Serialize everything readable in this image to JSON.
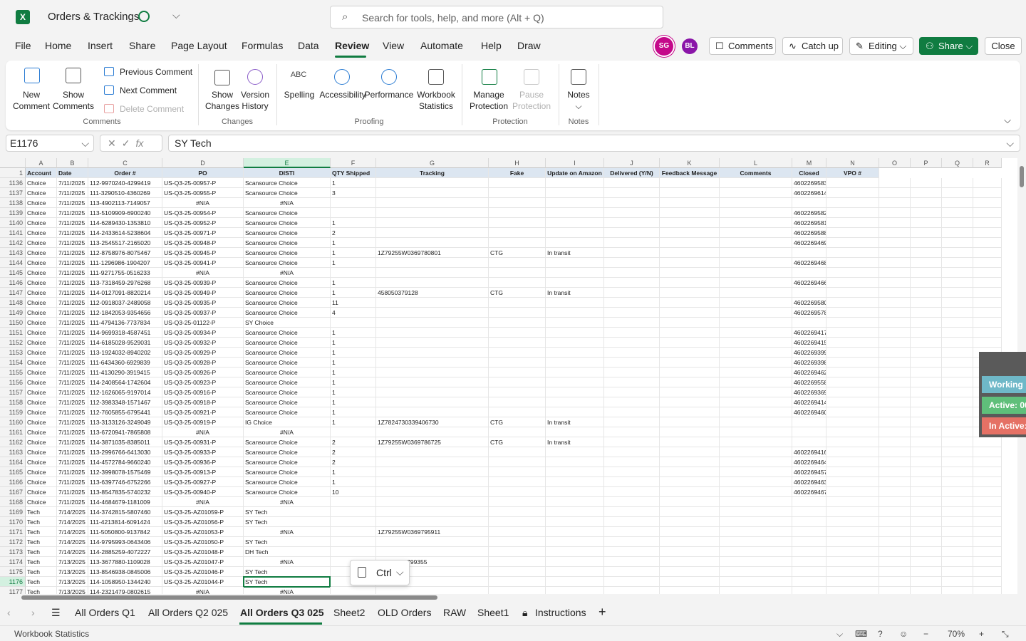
{
  "app": {
    "title": "Orders & Trackings",
    "search_placeholder": "Search for tools, help, and more (Alt + Q)",
    "brand_color": "#107c41"
  },
  "menu": {
    "tabs": [
      "File",
      "Home",
      "Insert",
      "Share",
      "Page Layout",
      "Formulas",
      "Data",
      "Review",
      "View",
      "Automate",
      "Help",
      "Draw"
    ],
    "active": "Review"
  },
  "avatars": [
    {
      "initials": "SG",
      "color": "#c4098a"
    },
    {
      "initials": "BL",
      "color": "#8a15a8"
    }
  ],
  "toolbar": {
    "comments": "Comments",
    "catchup": "Catch up",
    "editing": "Editing",
    "share": "Share",
    "close": "Close"
  },
  "ribbon": {
    "new_comment": [
      "New",
      "Comment"
    ],
    "show_comments": [
      "Show",
      "Comments"
    ],
    "previous_comment": "Previous Comment",
    "next_comment": "Next Comment",
    "delete_comment": "Delete Comment",
    "group_comments": "Comments",
    "show_changes": [
      "Show",
      "Changes"
    ],
    "version_history": [
      "Version",
      "History"
    ],
    "group_changes": "Changes",
    "spelling": "Spelling",
    "spelling_icon_text": "ABC",
    "accessibility": "Accessibility",
    "performance": "Performance",
    "workbook_statistics": [
      "Workbook",
      "Statistics"
    ],
    "group_proofing": "Proofing",
    "manage_protection": [
      "Manage",
      "Protection"
    ],
    "pause_protection": [
      "Pause",
      "Protection"
    ],
    "group_protection": "Protection",
    "notes": "Notes",
    "group_notes": "Notes"
  },
  "formula_bar": {
    "name_box": "E1176",
    "fx": "fx",
    "value": "SY Tech"
  },
  "sheet": {
    "columns": [
      "A",
      "B",
      "C",
      "D",
      "E",
      "F",
      "G",
      "H",
      "I",
      "J",
      "K",
      "L",
      "M",
      "N",
      "O",
      "P",
      "Q",
      "R"
    ],
    "selected_column": "E",
    "header_row_number": "1",
    "headers": [
      "Account",
      "Date",
      "Order #",
      "PO",
      "DISTI",
      "QTY Shipped",
      "Tracking",
      "Fake",
      "Update on Amazon",
      "Delivered (Y/N)",
      "Feedback Message",
      "Comments",
      "Closed",
      "VPO #"
    ],
    "selected_row": "1176",
    "rows": [
      [
        "1136",
        "Choice",
        "7/11/2025",
        "112-9970240-4299419",
        "US-Q3-25-00957-P",
        "Scansource Choice",
        "1",
        "",
        "",
        "",
        "",
        "",
        "",
        "4602269583"
      ],
      [
        "1137",
        "Choice",
        "7/11/2025",
        "111-3290510-4360269",
        "US-Q3-25-00955-P",
        "Scansource Choice",
        "3",
        "",
        "",
        "",
        "",
        "",
        "",
        "4602269614"
      ],
      [
        "1138",
        "Choice",
        "7/11/2025",
        "113-4902113-7149057",
        "#N/A",
        "#N/A",
        "",
        "",
        "",
        "",
        "",
        "",
        "",
        ""
      ],
      [
        "1139",
        "Choice",
        "7/11/2025",
        "113-5109909-6900240",
        "US-Q3-25-00954-P",
        "Scansource Choice",
        "",
        "",
        "",
        "",
        "",
        "",
        "",
        "4602269582"
      ],
      [
        "1140",
        "Choice",
        "7/11/2025",
        "114-6289430-1353810",
        "US-Q3-25-00952-P",
        "Scansource Choice",
        "1",
        "",
        "",
        "",
        "",
        "",
        "",
        "4602269581"
      ],
      [
        "1141",
        "Choice",
        "7/11/2025",
        "114-2433614-5238604",
        "US-Q3-25-00971-P",
        "Scansource Choice",
        "2",
        "",
        "",
        "",
        "",
        "",
        "",
        "4602269588"
      ],
      [
        "1142",
        "Choice",
        "7/11/2025",
        "113-2545517-2165020",
        "US-Q3-25-00948-P",
        "Scansource Choice",
        "1",
        "",
        "",
        "",
        "",
        "",
        "",
        "4602269469"
      ],
      [
        "1143",
        "Choice",
        "7/11/2025",
        "112-8758976-8075467",
        "US-Q3-25-00945-P",
        "Scansource Choice",
        "1",
        "1Z79255W0369780801",
        "CTG",
        "In transit",
        "",
        "",
        "",
        ""
      ],
      [
        "1144",
        "Choice",
        "7/11/2025",
        "111-1296986-1904207",
        "US-Q3-25-00941-P",
        "Scansource Choice",
        "1",
        "",
        "",
        "",
        "",
        "",
        "",
        "4602269468"
      ],
      [
        "1145",
        "Choice",
        "7/11/2025",
        "111-9271755-0516233",
        "#N/A",
        "#N/A",
        "",
        "",
        "",
        "",
        "",
        "",
        "",
        ""
      ],
      [
        "1146",
        "Choice",
        "7/11/2025",
        "113-7318459-2976268",
        "US-Q3-25-00939-P",
        "Scansource Choice",
        "1",
        "",
        "",
        "",
        "",
        "",
        "",
        "4602269466"
      ],
      [
        "1147",
        "Choice",
        "7/11/2025",
        "114-0127091-8820214",
        "US-Q3-25-00949-P",
        "Scansource Choice",
        "1",
        "458050379128",
        "CTG",
        "In transit",
        "",
        "",
        "",
        ""
      ],
      [
        "1148",
        "Choice",
        "7/11/2025",
        "112-0918037-2489058",
        "US-Q3-25-00935-P",
        "Scansource Choice",
        "11",
        "",
        "",
        "",
        "",
        "",
        "",
        "4602269580"
      ],
      [
        "1149",
        "Choice",
        "7/11/2025",
        "112-1842053-9354656",
        "US-Q3-25-00937-P",
        "Scansource Choice",
        "4",
        "",
        "",
        "",
        "",
        "",
        "",
        "4602269578"
      ],
      [
        "1150",
        "Choice",
        "7/11/2025",
        "111-4794136-7737834",
        "US-Q3-25-01122-P",
        "SY Choice",
        "",
        "",
        "",
        "",
        "",
        "",
        "",
        ""
      ],
      [
        "1151",
        "Choice",
        "7/11/2025",
        "114-9699318-4587451",
        "US-Q3-25-00934-P",
        "Scansource Choice",
        "1",
        "",
        "",
        "",
        "",
        "",
        "",
        "4602269417"
      ],
      [
        "1152",
        "Choice",
        "7/11/2025",
        "114-6185028-9529031",
        "US-Q3-25-00932-P",
        "Scansource Choice",
        "1",
        "",
        "",
        "",
        "",
        "",
        "",
        "4602269415"
      ],
      [
        "1153",
        "Choice",
        "7/11/2025",
        "113-1924032-8940202",
        "US-Q3-25-00929-P",
        "Scansource Choice",
        "1",
        "",
        "",
        "",
        "",
        "",
        "",
        "4602269399"
      ],
      [
        "1154",
        "Choice",
        "7/11/2025",
        "111-6434360-6929839",
        "US-Q3-25-00928-P",
        "Scansource Choice",
        "1",
        "",
        "",
        "",
        "",
        "",
        "",
        "4602269398"
      ],
      [
        "1155",
        "Choice",
        "7/11/2025",
        "111-4130290-3919415",
        "US-Q3-25-00926-P",
        "Scansource Choice",
        "1",
        "",
        "",
        "",
        "",
        "",
        "",
        "4602269462"
      ],
      [
        "1156",
        "Choice",
        "7/11/2025",
        "114-2408564-1742604",
        "US-Q3-25-00923-P",
        "Scansource Choice",
        "1",
        "",
        "",
        "",
        "",
        "",
        "",
        "4602269558"
      ],
      [
        "1157",
        "Choice",
        "7/11/2025",
        "112-1626065-9197014",
        "US-Q3-25-00916-P",
        "Scansource Choice",
        "1",
        "",
        "",
        "",
        "",
        "",
        "",
        "4602269369"
      ],
      [
        "1158",
        "Choice",
        "7/11/2025",
        "112-3983348-1571467",
        "US-Q3-25-00918-P",
        "Scansource Choice",
        "1",
        "",
        "",
        "",
        "",
        "",
        "",
        "4602269414"
      ],
      [
        "1159",
        "Choice",
        "7/11/2025",
        "112-7605855-6795441",
        "US-Q3-25-00921-P",
        "Scansource Choice",
        "1",
        "",
        "",
        "",
        "",
        "",
        "",
        "4602269460"
      ],
      [
        "1160",
        "Choice",
        "7/11/2025",
        "113-3133126-3249049",
        "US-Q3-25-00919-P",
        "IG Choice",
        "1",
        "1Z7824730339406730",
        "CTG",
        "In transit",
        "",
        "",
        "",
        ""
      ],
      [
        "1161",
        "Choice",
        "7/11/2025",
        "113-6720941-7865808",
        "#N/A",
        "#N/A",
        "",
        "",
        "",
        "",
        "",
        "",
        "",
        ""
      ],
      [
        "1162",
        "Choice",
        "7/11/2025",
        "114-3871035-8385011",
        "US-Q3-25-00931-P",
        "Scansource Choice",
        "2",
        "1Z79255W0369786725",
        "CTG",
        "In transit",
        "",
        "",
        "",
        ""
      ],
      [
        "1163",
        "Choice",
        "7/11/2025",
        "113-2996766-6413030",
        "US-Q3-25-00933-P",
        "Scansource Choice",
        "2",
        "",
        "",
        "",
        "",
        "",
        "",
        "4602269416"
      ],
      [
        "1164",
        "Choice",
        "7/11/2025",
        "114-4572784-9660240",
        "US-Q3-25-00936-P",
        "Scansource Choice",
        "2",
        "",
        "",
        "",
        "",
        "",
        "",
        "4602269464"
      ],
      [
        "1165",
        "Choice",
        "7/11/2025",
        "112-3998078-1575469",
        "US-Q3-25-00913-P",
        "Scansource Choice",
        "1",
        "",
        "",
        "",
        "",
        "",
        "",
        "4602269457"
      ],
      [
        "1166",
        "Choice",
        "7/11/2025",
        "113-6397746-6752266",
        "US-Q3-25-00927-P",
        "Scansource Choice",
        "1",
        "",
        "",
        "",
        "",
        "",
        "",
        "4602269463"
      ],
      [
        "1167",
        "Choice",
        "7/11/2025",
        "113-8547835-5740232",
        "US-Q3-25-00940-P",
        "Scansource Choice",
        "10",
        "",
        "",
        "",
        "",
        "",
        "",
        "4602269467"
      ],
      [
        "1168",
        "Choice",
        "7/11/2025",
        "114-4684679-1181009",
        "#N/A",
        "#N/A",
        "",
        "",
        "",
        "",
        "",
        "",
        "",
        ""
      ],
      [
        "1169",
        "Tech",
        "7/14/2025",
        "114-3742815-5807460",
        "US-Q3-25-AZ01059-P",
        "SY Tech",
        "",
        "",
        "",
        "",
        "",
        "",
        "",
        ""
      ],
      [
        "1170",
        "Tech",
        "7/14/2025",
        "111-4213814-6091424",
        "US-Q3-25-AZ01056-P",
        "SY Tech",
        "",
        "",
        "",
        "",
        "",
        "",
        "",
        ""
      ],
      [
        "1171",
        "Tech",
        "7/14/2025",
        "111-5050800-9137842",
        "US-Q3-25-AZ01053-P",
        "#N/A",
        "",
        "1Z79255W0369795911",
        "",
        "",
        "",
        "",
        "",
        ""
      ],
      [
        "1172",
        "Tech",
        "7/14/2025",
        "114-9795993-0643406",
        "US-Q3-25-AZ01050-P",
        "SY Tech",
        "",
        "",
        "",
        "",
        "",
        "",
        "",
        ""
      ],
      [
        "1173",
        "Tech",
        "7/14/2025",
        "114-2885259-4072227",
        "US-Q3-25-AZ01048-P",
        "DH Tech",
        "",
        "",
        "",
        "",
        "",
        "",
        "",
        ""
      ],
      [
        "1174",
        "Tech",
        "7/13/2025",
        "113-3677880-1109028",
        "US-Q3-25-AZ01047-P",
        "#N/A",
        "",
        "255W0369799355",
        "",
        "",
        "",
        "",
        "",
        ""
      ],
      [
        "1175",
        "Tech",
        "7/13/2025",
        "113-8546938-0845006",
        "US-Q3-25-AZ01046-P",
        "SY Tech",
        "",
        "",
        "",
        "",
        "",
        "",
        "",
        ""
      ],
      [
        "1176",
        "Tech",
        "7/13/2025",
        "114-1058950-1344240",
        "US-Q3-25-AZ01044-P",
        "SY Tech",
        "",
        "",
        "",
        "",
        "",
        "",
        "",
        ""
      ],
      [
        "1177",
        "Tech",
        "7/13/2025",
        "114-2321479-0802615",
        "#N/A",
        "#N/A",
        "",
        "",
        "",
        "",
        "",
        "",
        "",
        ""
      ]
    ]
  },
  "paste_popup": {
    "label": "Ctrl"
  },
  "widget": {
    "working": "Working",
    "active": "Active: 00",
    "inactive": "In Active:",
    "working_color": "#6fb8c8",
    "active_color": "#5fbf7a",
    "inactive_color": "#e57165"
  },
  "sheet_tabs": {
    "tabs": [
      "All Orders Q1",
      "All Orders Q2 025",
      "All Orders Q3 025",
      "Sheet2",
      "OLD Orders",
      "RAW",
      "Sheet1",
      "Instructions"
    ],
    "active": "All Orders Q3 025"
  },
  "status_bar": {
    "left": "Workbook Statistics",
    "zoom": "70%"
  }
}
